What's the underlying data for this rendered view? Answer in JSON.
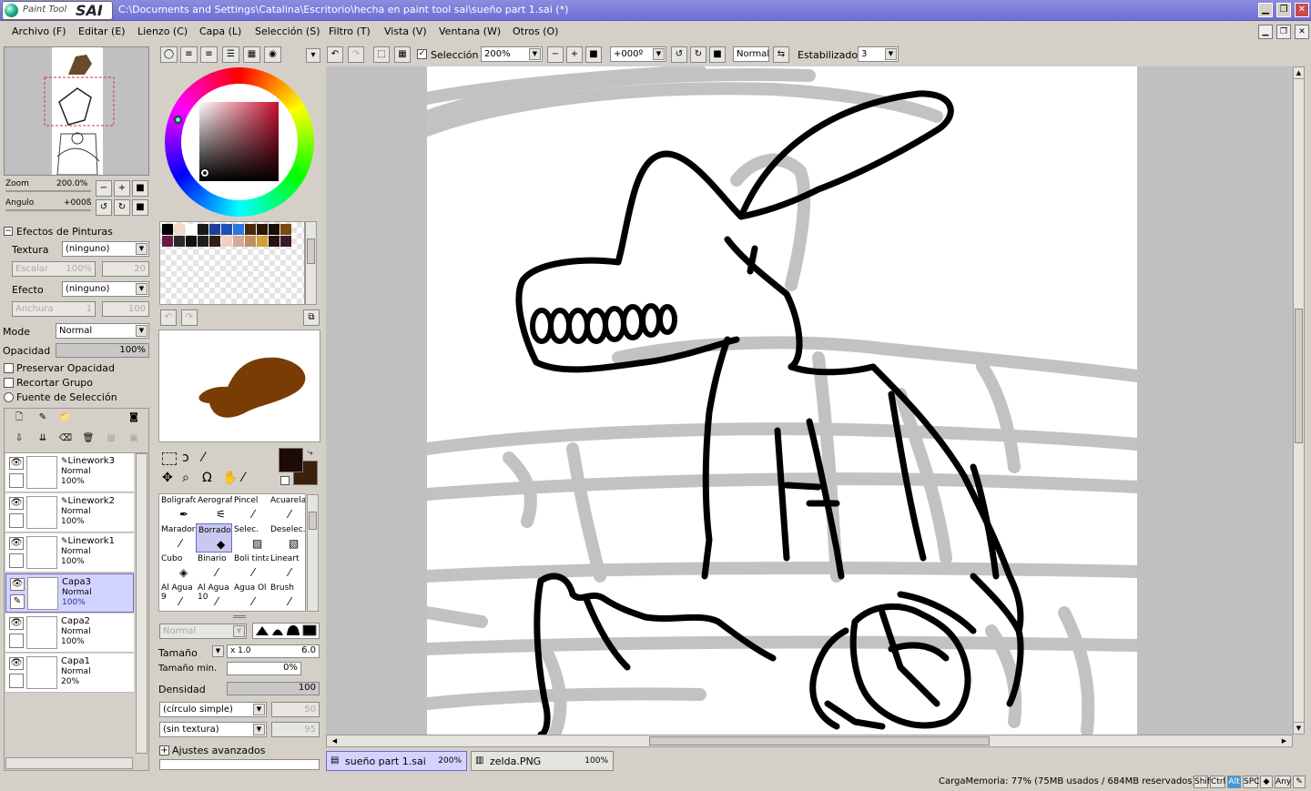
{
  "app": {
    "logo_text": "Paint Tool",
    "logo_brand": "SAI",
    "window_title": "C:\\Documents and Settings\\Catalina\\Escritorio\\hecha en paint tool sai\\sueño part 1.sai (*)"
  },
  "menu": [
    "Archivo (F)",
    "Editar (E)",
    "Lienzo (C)",
    "Capa (L)",
    "Selección (S)",
    "Filtro (T)",
    "Vista (V)",
    "Ventana (W)",
    "Otros (O)"
  ],
  "toolbar": {
    "selection_label": "Selección",
    "selection_checked": true,
    "zoom_value": "200%",
    "angle_value": "+000º",
    "blend_mode": "Normal",
    "stabilizer_label": "Estabilizador",
    "stabilizer_value": "3"
  },
  "navigator": {
    "zoom_label": "Zoom",
    "zoom_value": "200.0%",
    "angle_label": "Angulo",
    "angle_value": "+000ß"
  },
  "paint_effects": {
    "title": "Efectos de Pinturas",
    "texture_label": "Textura",
    "texture_value": "(ninguno)",
    "scale_label": "Escalar",
    "scale_value": "100%",
    "scale_value2": "20",
    "effect_label": "Efecto",
    "effect_value": "(ninguno)",
    "width_label": "Anchura",
    "width_value": "1",
    "width_value2": "100"
  },
  "layer_props": {
    "mode_label": "Mode",
    "mode_value": "Normal",
    "opacity_label": "Opacidad",
    "opacity_value": "100%",
    "preserve_opacity": "Preservar Opacidad",
    "clip_group": "Recortar Grupo",
    "selection_source": "Fuente de Selección"
  },
  "layers": [
    {
      "name": "Lineworkl3",
      "display": "Linework3",
      "mode": "Normal",
      "opacity": "100%",
      "type": "linework",
      "selected": false
    },
    {
      "name": "Linework2",
      "display": "Linework2",
      "mode": "Normal",
      "opacity": "100%",
      "type": "linework",
      "selected": false
    },
    {
      "name": "Linework1",
      "display": "Linework1",
      "mode": "Normal",
      "opacity": "100%",
      "type": "linework",
      "selected": false
    },
    {
      "name": "Capa3",
      "display": "Capa3",
      "mode": "Normal",
      "opacity": "100%",
      "type": "raster",
      "selected": true
    },
    {
      "name": "Capa2",
      "display": "Capa2",
      "mode": "Normal",
      "opacity": "100%",
      "type": "raster",
      "selected": false
    },
    {
      "name": "Capa1",
      "display": "Capa1",
      "mode": "Normal",
      "opacity": "20%",
      "type": "raster",
      "selected": false
    }
  ],
  "tools": [
    {
      "label": "Boligrafo",
      "icon": "pen-icon"
    },
    {
      "label": "Aerograf",
      "icon": "airbrush-icon"
    },
    {
      "label": "Pincel",
      "icon": "brush-icon"
    },
    {
      "label": "Acuarela",
      "icon": "watercolor-icon"
    },
    {
      "label": "Marador",
      "icon": "marker-icon"
    },
    {
      "label": "Borrador",
      "icon": "eraser-icon",
      "selected": true
    },
    {
      "label": "Selec.",
      "icon": "select-pen-icon"
    },
    {
      "label": "Deselec.",
      "icon": "deselect-pen-icon"
    },
    {
      "label": "Cubo",
      "icon": "bucket-icon"
    },
    {
      "label": "Binario",
      "icon": "binary-pen-icon"
    },
    {
      "label": "Boli tinta",
      "icon": "ink-pen-icon"
    },
    {
      "label": "Lineart",
      "icon": "lineart-icon"
    },
    {
      "label": "Al Agua",
      "sub": "9",
      "icon": "water-brush-icon"
    },
    {
      "label": "Al Agua",
      "sub": "10",
      "icon": "water-brush-icon"
    },
    {
      "label": "Agua Ol",
      "icon": "oil-water-icon"
    },
    {
      "label": "Brush",
      "icon": "brush-icon"
    }
  ],
  "brush": {
    "mode_value": "Normal",
    "size_label": "Tamaño",
    "size_mult": "x 1.0",
    "size_value": "6.0",
    "min_size_label": "Tamaño min.",
    "min_size_value": "0%",
    "density_label": "Densidad",
    "density_value": "100",
    "shape_value": "(círculo simple)",
    "shape_num": "50",
    "texture_value": "(sin textura)",
    "texture_num": "95",
    "advanced_label": "Ajustes avanzados"
  },
  "colors": {
    "primary": "#1e0a06",
    "secondary": "#3c200a",
    "preview_brush": "#7a3c05",
    "title_bar": "#7a7ad9",
    "selected_bg": "#d3d3ff",
    "palette": [
      "#000000",
      "#f4d8c8",
      "#ffffff",
      "#1a1a1a",
      "#1c3f9a",
      "#1f4fb5",
      "#2d78e0",
      "#4a2a0f",
      "#2b170a",
      "#1a0d05",
      "#7a4a10",
      "#6a1846",
      "#2a2a2a",
      "#111111",
      "#1e1e1e",
      "#2e1e12",
      "#f3cfc0",
      "#d8a89a",
      "#c09060",
      "#c9a238",
      "#2a1010",
      "#3a1a2a"
    ]
  },
  "tabs": [
    {
      "name": "sueño part 1.sai",
      "zoom": "200%",
      "selected": true
    },
    {
      "name": "zelda.PNG",
      "zoom": "100%",
      "selected": false
    }
  ],
  "status": {
    "memory": "CargaMemoria: 77% (75MB usados / 684MB reservados)",
    "keys": [
      "Shift",
      "Ctrl",
      "Alt",
      "SPC",
      "◆",
      "Any",
      "✎"
    ]
  }
}
